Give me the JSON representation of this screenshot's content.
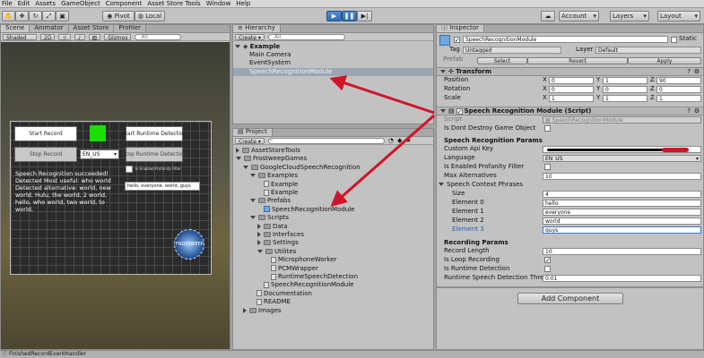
{
  "menu": [
    "File",
    "Edit",
    "Assets",
    "GameObject",
    "Component",
    "Asset Store Tools",
    "Window",
    "Help"
  ],
  "toolbar": {
    "pivot": "Pivot",
    "local": "Local",
    "account": "Account",
    "layers": "Layers",
    "layout": "Layout"
  },
  "scene": {
    "tabs": [
      "Scene",
      "Animator",
      "Asset Store",
      "Profiler"
    ],
    "shaded": "Shaded",
    "mode_2d": "2D",
    "gizmos": "Gizmos",
    "search": "All",
    "game": {
      "start_record": "Start Record",
      "stop_record": "Stop Record",
      "start_runtime": "Start Runtime Detection",
      "stop_runtime": "Stop Runtime Detection",
      "language": "EN_US",
      "profanity_label": "Is Enabled Profanity Filter",
      "phrases_input": "hello, everyone, world, guys",
      "result_text": "Speech Recognition succeeded! Detected Most useful: who world Detected alternative: world, new world, Hulu, the world, 2 world, hello, who world, two world, to world,",
      "logo_text": "FROSTWEEP"
    }
  },
  "hierarchy": {
    "title": "Hierarchy",
    "create": "Create",
    "search": "All",
    "items": [
      {
        "label": "Example",
        "depth": 0
      },
      {
        "label": "Main Camera",
        "depth": 1
      },
      {
        "label": "EventSystem",
        "depth": 1
      },
      {
        "label": "SpeechRecognitionModule",
        "depth": 1,
        "selected": true
      }
    ]
  },
  "project": {
    "title": "Project",
    "create": "Create",
    "tree": [
      {
        "label": "AssetStoreTools",
        "depth": 0,
        "type": "folder",
        "expanded": false
      },
      {
        "label": "FrostweepGames",
        "depth": 0,
        "type": "folder",
        "expanded": true
      },
      {
        "label": "GoogleCloudSpeechRecognition",
        "depth": 1,
        "type": "folder",
        "expanded": true
      },
      {
        "label": "Examples",
        "depth": 2,
        "type": "folder",
        "expanded": true
      },
      {
        "label": "Example",
        "depth": 3,
        "type": "asset"
      },
      {
        "label": "Example",
        "depth": 3,
        "type": "asset"
      },
      {
        "label": "Prefabs",
        "depth": 2,
        "type": "folder",
        "expanded": true
      },
      {
        "label": "SpeechRecognitionModule",
        "depth": 3,
        "type": "prefab"
      },
      {
        "label": "Scripts",
        "depth": 2,
        "type": "folder",
        "expanded": true
      },
      {
        "label": "Data",
        "depth": 3,
        "type": "folder",
        "expanded": false
      },
      {
        "label": "Interfaces",
        "depth": 3,
        "type": "folder",
        "expanded": false
      },
      {
        "label": "Settings",
        "depth": 3,
        "type": "folder",
        "expanded": false
      },
      {
        "label": "Utilites",
        "depth": 3,
        "type": "folder",
        "expanded": true
      },
      {
        "label": "MicrophoneWorker",
        "depth": 4,
        "type": "asset"
      },
      {
        "label": "PCMWrapper",
        "depth": 4,
        "type": "asset"
      },
      {
        "label": "RuntimeSpeechDetection",
        "depth": 4,
        "type": "asset"
      },
      {
        "label": "SpeechRecognitionModule",
        "depth": 3,
        "type": "asset"
      },
      {
        "label": "Documentation",
        "depth": 2,
        "type": "asset"
      },
      {
        "label": "README",
        "depth": 2,
        "type": "asset"
      },
      {
        "label": "Images",
        "depth": 1,
        "type": "folder",
        "expanded": false
      }
    ]
  },
  "inspector": {
    "title": "Inspector",
    "object_name": "SpeechRecognitionModule",
    "static": "Static",
    "tag_label": "Tag",
    "tag_value": "Untagged",
    "layer_label": "Layer",
    "layer_value": "Default",
    "prefab_label": "Prefab",
    "prefab_select": "Select",
    "prefab_revert": "Revert",
    "prefab_apply": "Apply",
    "transform": {
      "title": "Transform",
      "rows": [
        {
          "label": "Position",
          "x": "0",
          "y": "1",
          "z": "90"
        },
        {
          "label": "Rotation",
          "x": "0",
          "y": "0",
          "z": "0"
        },
        {
          "label": "Scale",
          "x": "1",
          "y": "1",
          "z": "1"
        }
      ]
    },
    "script_component": {
      "title": "Speech Recognition Module (Script)",
      "script_label": "Script",
      "script_value": "SpeechRecognitionModule",
      "dont_destroy_label": "Is Dont Destroy Game Object"
    },
    "params": {
      "title": "Speech Recognition Params",
      "api_key_label": "Custom Api Key",
      "language_label": "Language",
      "language_value": "EN_US",
      "profanity_label": "Is Enabled Profanity Filter",
      "max_alt_label": "Max Alternatives",
      "max_alt_value": "10",
      "phrases_label": "Speech Context Phrases",
      "size_label": "Size",
      "size_value": "4",
      "elements": [
        {
          "label": "Element 0",
          "value": "hello"
        },
        {
          "label": "Element 1",
          "value": "everyone"
        },
        {
          "label": "Element 2",
          "value": "world"
        },
        {
          "label": "Element 3",
          "value": "guys"
        }
      ]
    },
    "recording": {
      "title": "Recording Params",
      "length_label": "Record Length",
      "length_value": "10",
      "loop_label": "Is Loop Recording",
      "runtime_label": "Is Runtime Detection",
      "threshold_label": "Runtime Speech Detection Thresho",
      "threshold_value": "0.01"
    },
    "add_component": "Add Component"
  },
  "status": {
    "text": "FinishedRecordEventHandler"
  },
  "colors": {
    "selection": "#9aa6b4",
    "play_blue": "#3a7bd5",
    "arrow_red": "#d0142a",
    "green_square": "#18e000"
  }
}
